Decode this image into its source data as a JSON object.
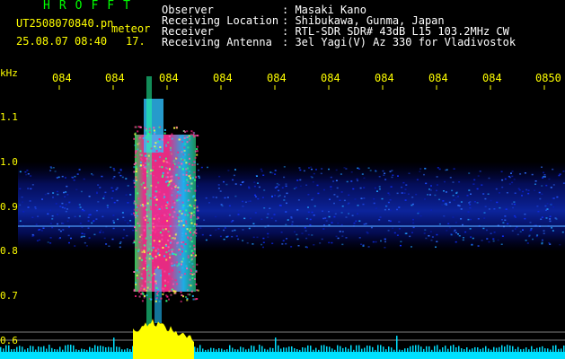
{
  "header": {
    "program_name": "HROFFT",
    "filename": "UT2508070840.pn",
    "detection_label": "meteor",
    "datetime": "25.08.07 08:40",
    "frame_number": "17."
  },
  "station_info": [
    {
      "label": "Observer",
      "value": ": Masaki Kano"
    },
    {
      "label": "Receiving Location",
      "value": ": Shibukawa, Gunma, Japan"
    },
    {
      "label": "Receiver",
      "value": ": RTL-SDR SDR# 43dB L15 103.2MHz CW"
    },
    {
      "label": "Receiving Antenna",
      "value": ": 3el Yagi(V) Az 330 for Vladivostok"
    }
  ],
  "spectrogram": {
    "y_unit": "kHz",
    "y_ticks": [
      "1.1",
      "1.0",
      "0.9",
      "0.8",
      "0.7",
      "0.6"
    ],
    "x_ticks": [
      "084",
      "084",
      "084",
      "084",
      "084",
      "084",
      "084",
      "084",
      "084",
      "0850"
    ],
    "colors": {
      "background": "#000000",
      "text_primary": "#ffff00",
      "text_info": "#ffffff",
      "program_name": "#00ff00",
      "tick_marks": "#ffff00",
      "signal_band": "#3050ff",
      "meteor_core": "#ff3090",
      "power_trace": "#ffff00",
      "noise_floor": "#00e0ff"
    }
  }
}
